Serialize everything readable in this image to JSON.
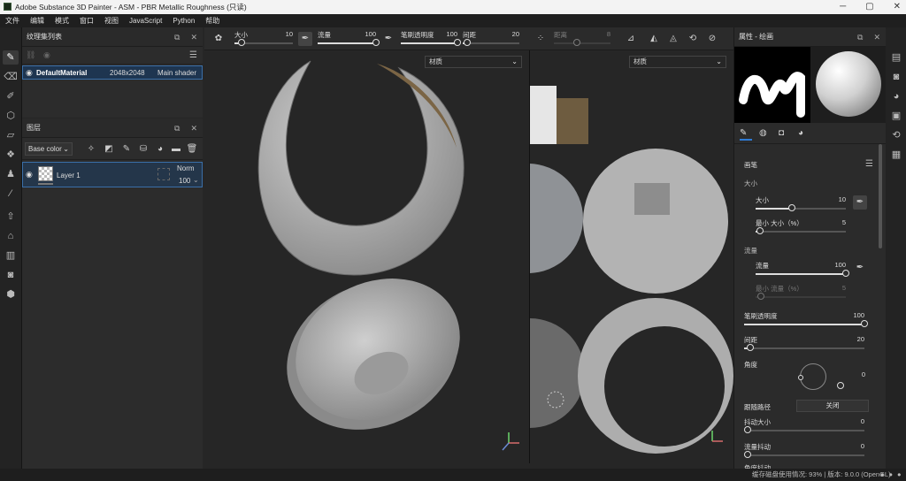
{
  "window": {
    "title": "Adobe Substance 3D Painter - ASM - PBR Metallic Roughness (只读)",
    "minimize": "─",
    "maximize": "▢",
    "close": "✕"
  },
  "menu": [
    "文件",
    "编辑",
    "模式",
    "窗口",
    "视图",
    "JavaScript",
    "Python",
    "帮助"
  ],
  "texture_set_list": {
    "title": "纹理集列表",
    "rows": [
      {
        "name": "DefaultMaterial",
        "size": "2048x2048",
        "shader": "Main shader"
      }
    ]
  },
  "layers": {
    "title": "图层",
    "channel": "Base color",
    "items": [
      {
        "name": "Layer 1",
        "blend": "Norm",
        "opacity": "100"
      }
    ]
  },
  "toolbar": {
    "size_label": "大小",
    "size_value": "10",
    "size_level": 0.12,
    "flow_label": "流量",
    "flow_value": "100",
    "flow_level": 1.0,
    "opacity_label": "笔刷透明度",
    "opacity_value": "100",
    "opacity_level": 1.0,
    "spacing_label": "间距",
    "spacing_value": "20",
    "spacing_level": 0.08,
    "distance_label": "距离",
    "distance_value": "8"
  },
  "viewport3d": {
    "material_dropdown": "材质"
  },
  "viewport2d": {
    "material_dropdown": "材质"
  },
  "properties": {
    "title": "属性 - 绘画",
    "section_brush": "画笔",
    "group_size": "大小",
    "size_label": "大小",
    "size_value": "10",
    "size_level": 0.4,
    "min_size_label": "最小 大小（%）",
    "min_size_value": "5",
    "min_size_level": 0.05,
    "group_flow": "流量",
    "flow_label": "流量",
    "flow_value": "100",
    "flow_level": 1.0,
    "min_flow_label": "最小 流量（%）",
    "min_flow_value": "5",
    "opacity_label": "笔刷透明度",
    "opacity_value": "100",
    "opacity_level": 1.0,
    "spacing_label": "间距",
    "spacing_value": "20",
    "spacing_level": 0.05,
    "angle_label": "角度",
    "angle_value": "0",
    "follow_path_label": "跟随路径",
    "follow_path_value": "关闭",
    "jitter_size_label": "抖动大小",
    "jitter_size_value": "0",
    "flow_jitter_label": "流量抖动",
    "flow_jitter_value": "0",
    "cut_label": "角度抖动"
  },
  "status": {
    "text": "缓存磁盘使用情况: 93% | 版本: 9.0.0 (OpenGL)"
  },
  "colors": {
    "accent": "#2e7bd6",
    "panel": "#2c2c2c",
    "viewport": "#262626"
  }
}
